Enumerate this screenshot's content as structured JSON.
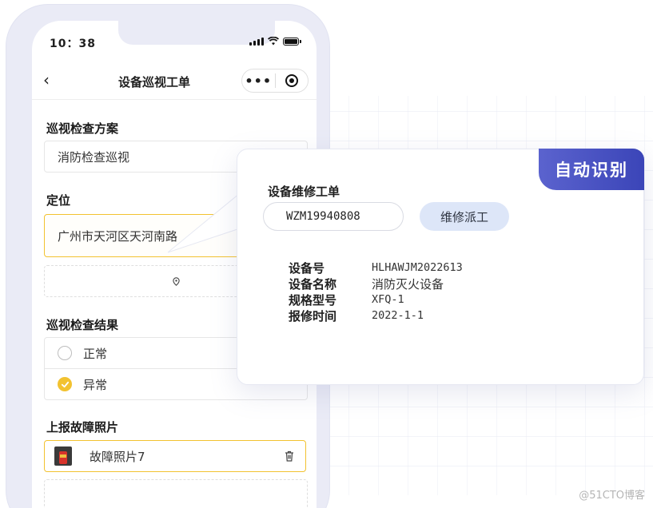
{
  "status_bar": {
    "time": "10：38"
  },
  "navbar": {
    "title": "设备巡视工单",
    "more_icon": "•••"
  },
  "form": {
    "plan": {
      "label": "巡视检查方案",
      "value": "消防检查巡视"
    },
    "location": {
      "label": "定位",
      "value": "广州市天河区天河南路"
    },
    "result": {
      "label": "巡视检查结果",
      "options": [
        {
          "label": "正常",
          "checked": false
        },
        {
          "label": "异常",
          "checked": true
        }
      ]
    },
    "photos": {
      "label": "上报故障照片",
      "items": [
        {
          "name": "故障照片7"
        }
      ]
    }
  },
  "popup": {
    "badge": "自动识别",
    "title": "设备维修工单",
    "order_number": "WZM19940808",
    "dispatch_button": "维修派工",
    "details": [
      {
        "key": "设备号",
        "value": "HLHAWJM2022613"
      },
      {
        "key": "设备名称",
        "value": "消防灭火设备"
      },
      {
        "key": "规格型号",
        "value": "XFQ-1"
      },
      {
        "key": "报修时间",
        "value": "2022-1-1"
      }
    ]
  },
  "watermark": "@51CTO博客",
  "colors": {
    "accent_yellow": "#f2c230",
    "badge_blue": "#3b45b8",
    "button_blue_light": "#dde6f8",
    "phone_frame": "#eaebf6"
  }
}
